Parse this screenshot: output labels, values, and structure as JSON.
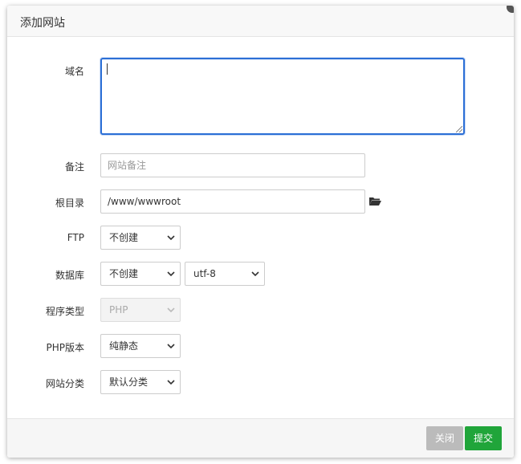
{
  "dialog": {
    "title": "添加网站"
  },
  "form": {
    "domain": {
      "label": "域名",
      "value": ""
    },
    "remark": {
      "label": "备注",
      "placeholder": "网站备注"
    },
    "root": {
      "label": "根目录",
      "value": "/www/wwwroot"
    },
    "ftp": {
      "label": "FTP",
      "selected": "不创建"
    },
    "database": {
      "label": "数据库",
      "selected": "不创建",
      "charset": "utf-8"
    },
    "program_type": {
      "label": "程序类型",
      "selected": "PHP",
      "disabled": true
    },
    "php_version": {
      "label": "PHP版本",
      "selected": "纯静态"
    },
    "category": {
      "label": "网站分类",
      "selected": "默认分类"
    }
  },
  "footer": {
    "close_label": "关闭",
    "submit_label": "提交"
  },
  "colors": {
    "accent": "#20a53a",
    "focus_border": "#2c6fd6",
    "disabled_button": "#bbbbbb"
  }
}
